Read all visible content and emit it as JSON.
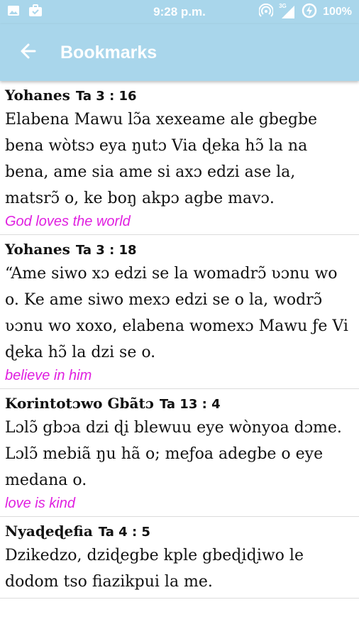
{
  "status_bar": {
    "time": "9:28 p.m.",
    "network": "3G",
    "battery": "100%",
    "icons": [
      "image-icon",
      "briefcase-check-icon",
      "hotspot-icon",
      "signal-icon",
      "data-saver-icon"
    ]
  },
  "app_bar": {
    "title": "Bookmarks",
    "back_icon": "arrow-left-icon",
    "color": "#a9d6eb"
  },
  "bookmarks": [
    {
      "book": "Yohanes",
      "chapter": "Ta 3 : 16",
      "text": "Elabena Mawu lɔ̃a xexeame ale gbegbe bena wòtsɔ eya ŋutɔ Via ɖeka hɔ̃ la na bena, ame sia ame si axɔ edzi ase la, matsrɔ̃ o, ke boŋ akpɔ agbe mavɔ.",
      "note": "God loves the world"
    },
    {
      "book": "Yohanes",
      "chapter": "Ta 3 : 18",
      "text": "“Ame siwo xɔ edzi se la womadrɔ̃ ʋɔnu wo o. Ke ame siwo mexɔ edzi se o la, wodrɔ̃ ʋɔnu wo xoxo, elabena womexɔ Mawu ƒe Vi ɖeka hɔ̃ la dzi se o.",
      "note": "believe in him"
    },
    {
      "book": "Korintotɔwo Gbãtɔ",
      "chapter": "Ta 13 : 4",
      "text": "Lɔlɔ̃ gbɔa dzi ɖi blewuu eye wònyoa dɔme. Lɔlɔ̃ mebiã ŋu hã o; meƒoa adegbe o eye medana o.",
      "note": "love is kind"
    },
    {
      "book": "Nyaɖeɖefia",
      "chapter": "Ta 4 : 5",
      "text": "Dzikedzo, dziɖegbe kple gbeɖiɖiwo le dodom tso fiazikpui la me.",
      "note": ""
    }
  ],
  "colors": {
    "note": "#e020e0",
    "divider": "#dcdcdc"
  }
}
